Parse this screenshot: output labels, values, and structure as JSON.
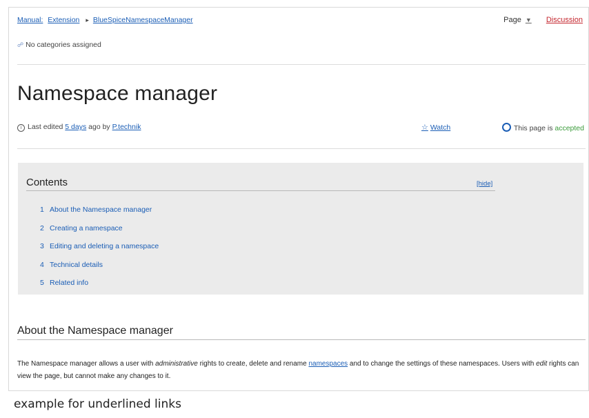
{
  "breadcrumb": {
    "items": [
      "Manual:",
      "Extension",
      "BlueSpiceNamespaceManager"
    ],
    "separator": "▸"
  },
  "tabs": {
    "page_label": "Page",
    "page_caret": "▼",
    "discussion_label": "Discussion"
  },
  "categories": {
    "icon": "tag-icon",
    "text": "No categories assigned"
  },
  "page_title": "Namespace manager",
  "meta": {
    "icon": "info-icon",
    "prefix": "Last edited",
    "when_link": "5 days",
    "middle": "ago by",
    "user_link": "P.technik",
    "watch_icon": "star-icon",
    "watch_label": "Watch",
    "status_icon": "review-icon",
    "status_prefix": "This page is",
    "status_value": "accepted"
  },
  "toc": {
    "title": "Contents",
    "hide_label": "[hide]",
    "items": [
      {
        "num": "1",
        "label": "About the Namespace manager"
      },
      {
        "num": "2",
        "label": "Creating a namespace"
      },
      {
        "num": "3",
        "label": "Editing and deleting a namespace"
      },
      {
        "num": "4",
        "label": "Technical details"
      },
      {
        "num": "5",
        "label": "Related info"
      }
    ]
  },
  "section": {
    "heading": "About the Namespace manager",
    "p1": "The Namespace manager allows a user with ",
    "p1_em": "administrative",
    "p2": " rights to create, delete and rename ",
    "p2_link": "namespaces",
    "p3": " and to change the settings of these namespaces. Users with ",
    "p3_em": "edit",
    "p4": " rights can view the page, but cannot make any changes to it."
  },
  "caption": "example for underlined links",
  "colors": {
    "link": "#1a5db5",
    "discussion": "#c4262e",
    "accepted": "#3a9b3a",
    "toc_bg": "#ebebeb"
  }
}
